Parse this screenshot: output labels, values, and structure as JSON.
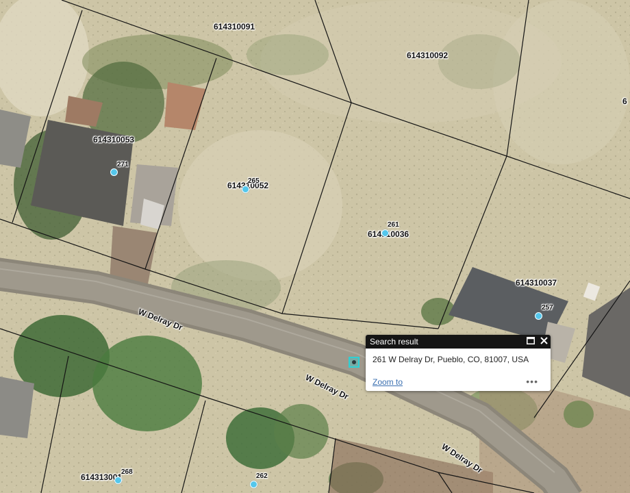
{
  "map": {
    "parcels": [
      "614310091",
      "614310092",
      "614310053",
      "614310052",
      "614310036",
      "614310037",
      "614313001"
    ],
    "addresses": [
      "271",
      "265",
      "261",
      "257",
      "268",
      "262"
    ],
    "roads": [
      "W Delray Dr",
      "W Delray Dr",
      "W Delray Dr"
    ],
    "partial_label": "6"
  },
  "popup": {
    "title": "Search result",
    "address": "261 W Delray Dr, Pueblo, CO, 81007, USA",
    "zoom_label": "Zoom to",
    "more_label": "•••",
    "maximize_icon": "maximize-icon",
    "close_icon": "close-icon"
  },
  "colors": {
    "point": "#54c7ec",
    "marker": "#2fd0d4",
    "popup_header": "#151515",
    "link": "#3a6fb0"
  }
}
